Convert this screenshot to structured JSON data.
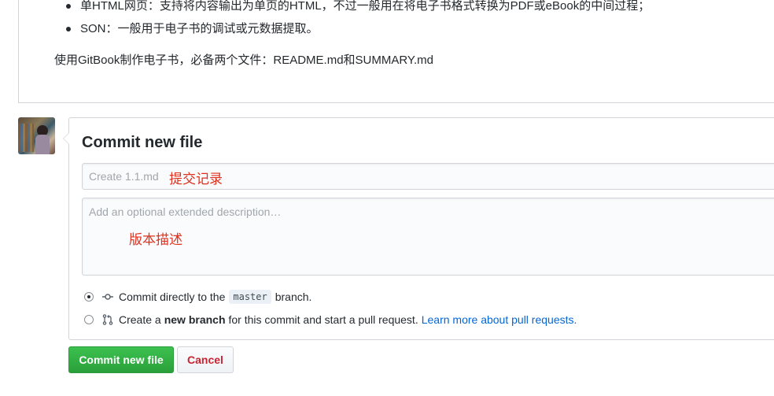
{
  "readme": {
    "bullets": [
      "单HTML网页：支持将内容输出为单页的HTML，不过一般用在将电子书格式转换为PDF或eBook的中间过程；",
      "SON：一般用于电子书的调试或元数据提取。"
    ],
    "paragraph": "使用GitBook制作电子书，必备两个文件：README.md和SUMMARY.md"
  },
  "commit": {
    "title": "Commit new file",
    "summary_placeholder": "Create 1.1.md",
    "summary_annotation": "提交记录",
    "description_placeholder": "Add an optional extended description…",
    "description_annotation": "版本描述",
    "option_direct": {
      "prefix": "Commit directly to the",
      "branch": "master",
      "suffix": "branch."
    },
    "option_new_branch": {
      "prefix": "Create a",
      "bold": "new branch",
      "suffix": "for this commit and start a pull request.",
      "link": "Learn more about pull requests."
    },
    "submit_label": "Commit new file",
    "cancel_label": "Cancel"
  },
  "colors": {
    "annotation_red": "#e0301e",
    "primary_green": "#2ea44f",
    "link_blue": "#0366d6",
    "cancel_red": "#cb2431"
  },
  "icons": [
    "git-commit-icon",
    "git-pull-request-icon",
    "radio-icon"
  ]
}
